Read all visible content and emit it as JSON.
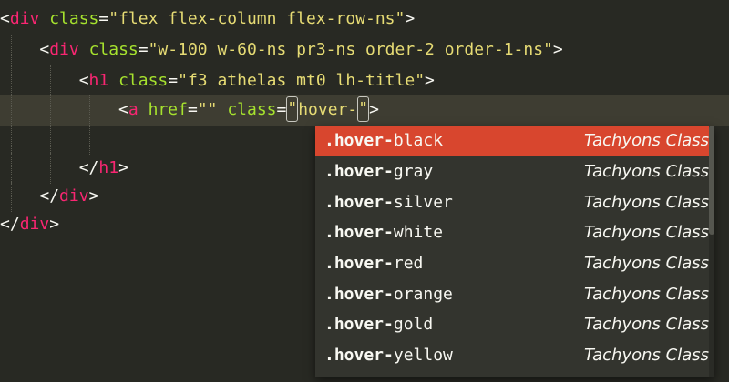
{
  "editor": {
    "lines": [
      {
        "indent": "",
        "open": "<",
        "tag": "div",
        "attr": "class",
        "eq": "=",
        "value": "\"flex flex-column flex-row-ns\"",
        "close": ">"
      },
      {
        "indent": "    ",
        "open": "<",
        "tag": "div",
        "attr": "class",
        "eq": "=",
        "value": "\"w-100 w-60-ns pr3-ns order-2 order-1-ns\"",
        "close": ">"
      },
      {
        "indent": "        ",
        "open": "<",
        "tag": "h1",
        "attr": "class",
        "eq": "=",
        "value": "\"f3 athelas mt0 lh-title\"",
        "close": ">"
      },
      {
        "indent": "            ",
        "open": "<",
        "tag": "a",
        "attr_href": "href",
        "eq1": "=",
        "value_href": "\"\"",
        "attr": "class",
        "eq": "=",
        "q_open": "\"",
        "typed": "hover-",
        "q_close": "\"",
        "close": ">"
      },
      {
        "indent": "",
        "text": ""
      },
      {
        "indent": "        ",
        "open": "</",
        "tag": "h1",
        "close": ">"
      },
      {
        "indent": "    ",
        "open": "</",
        "tag": "div",
        "close": ">"
      },
      {
        "indent": "",
        "open": "</",
        "tag": "div",
        "close": ">"
      }
    ]
  },
  "autocomplete": {
    "items": [
      {
        "prefix": ".hover-",
        "rest": "black",
        "kind": "Tachyons Class"
      },
      {
        "prefix": ".hover-",
        "rest": "gray",
        "kind": "Tachyons Class"
      },
      {
        "prefix": ".hover-",
        "rest": "silver",
        "kind": "Tachyons Class"
      },
      {
        "prefix": ".hover-",
        "rest": "white",
        "kind": "Tachyons Class"
      },
      {
        "prefix": ".hover-",
        "rest": "red",
        "kind": "Tachyons Class"
      },
      {
        "prefix": ".hover-",
        "rest": "orange",
        "kind": "Tachyons Class"
      },
      {
        "prefix": ".hover-",
        "rest": "gold",
        "kind": "Tachyons Class"
      },
      {
        "prefix": ".hover-",
        "rest": "yellow",
        "kind": "Tachyons Class"
      }
    ],
    "selected_index": 0
  },
  "colors": {
    "background": "#282923",
    "tag": "#f92672",
    "attribute": "#a6e22e",
    "string": "#e6db74",
    "selection": "#d8462e"
  }
}
